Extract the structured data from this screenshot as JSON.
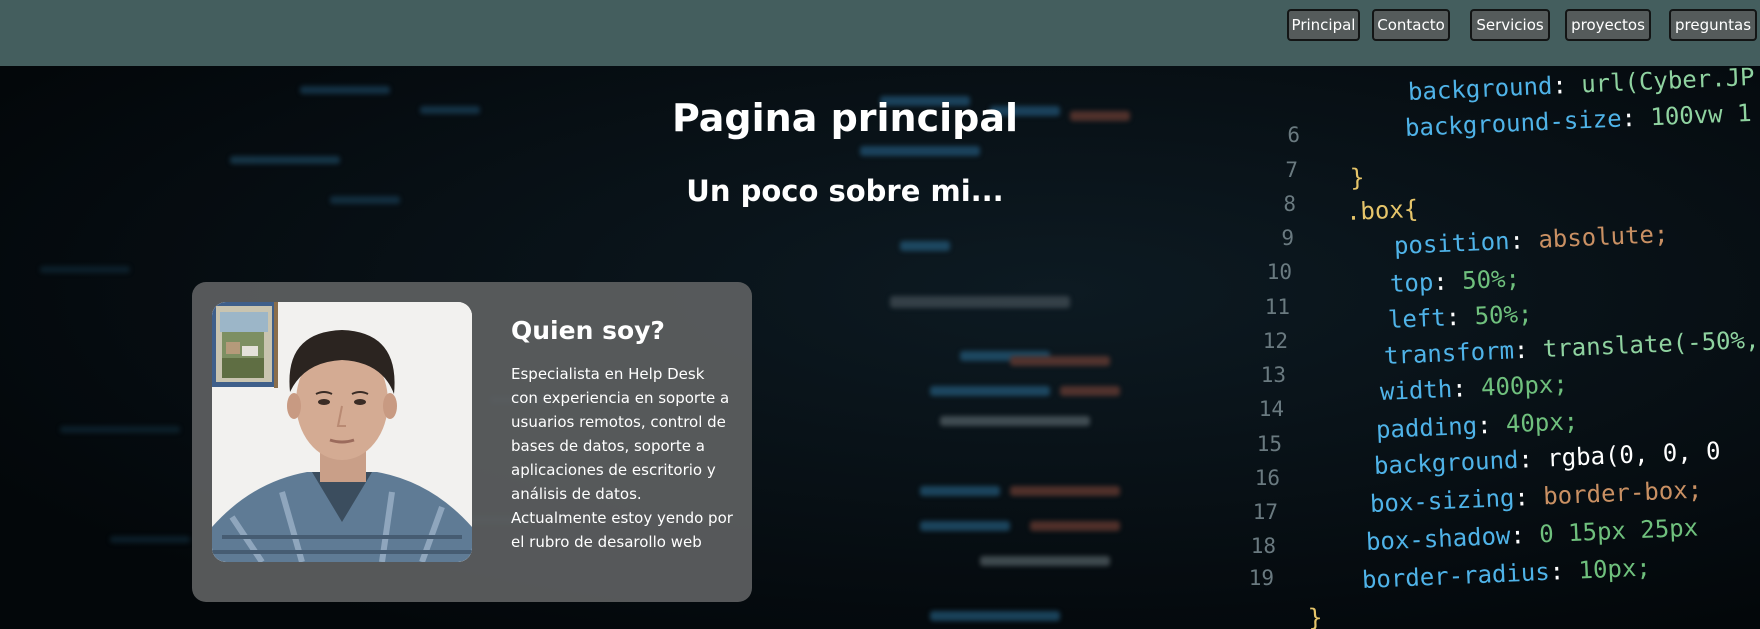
{
  "nav": {
    "items": [
      {
        "label": "Principal"
      },
      {
        "label": "Contacto"
      },
      {
        "label": "Servicios"
      },
      {
        "label": "proyectos"
      },
      {
        "label": "preguntas"
      }
    ]
  },
  "main": {
    "title": "Pagina principal",
    "subtitle": "Un poco sobre mi..."
  },
  "about": {
    "heading": "Quien soy?",
    "text": "Especialista en Help Desk con experiencia en soporte a usuarios remotos, control de bases de datos, soporte a aplicaciones de escritorio y análisis de datos. Actualmente estoy yendo por el rubro de desarollo web"
  },
  "background_code": {
    "line_numbers": [
      "6",
      "7",
      "8",
      "9",
      "10",
      "11",
      "12",
      "13",
      "14",
      "15",
      "16",
      "17",
      "18",
      "19"
    ],
    "lines": [
      {
        "prop": "background",
        "value": "url(Cyber.JP"
      },
      {
        "prop": "background-size",
        "value": "100vw 1"
      },
      {
        "prop": "}",
        "value": ""
      },
      {
        "prop": ".box{",
        "value": ""
      },
      {
        "prop": "position",
        "value": "absolute;"
      },
      {
        "prop": "top",
        "value": "50%;"
      },
      {
        "prop": "left",
        "value": "50%;"
      },
      {
        "prop": "transform",
        "value": "translate(-50%,"
      },
      {
        "prop": "width",
        "value": "400px;"
      },
      {
        "prop": "padding",
        "value": "40px;"
      },
      {
        "prop": "background",
        "value": "rgba(0, 0, 0"
      },
      {
        "prop": "box-sizing",
        "value": "border-box;"
      },
      {
        "prop": "box-shadow",
        "value": "0 15px 25px"
      },
      {
        "prop": "border-radius",
        "value": "10px;"
      },
      {
        "prop": "}",
        "value": ""
      }
    ]
  },
  "colors": {
    "header": "#445e5e",
    "nav_button": "#555b5b",
    "card": "#5c5f60"
  }
}
